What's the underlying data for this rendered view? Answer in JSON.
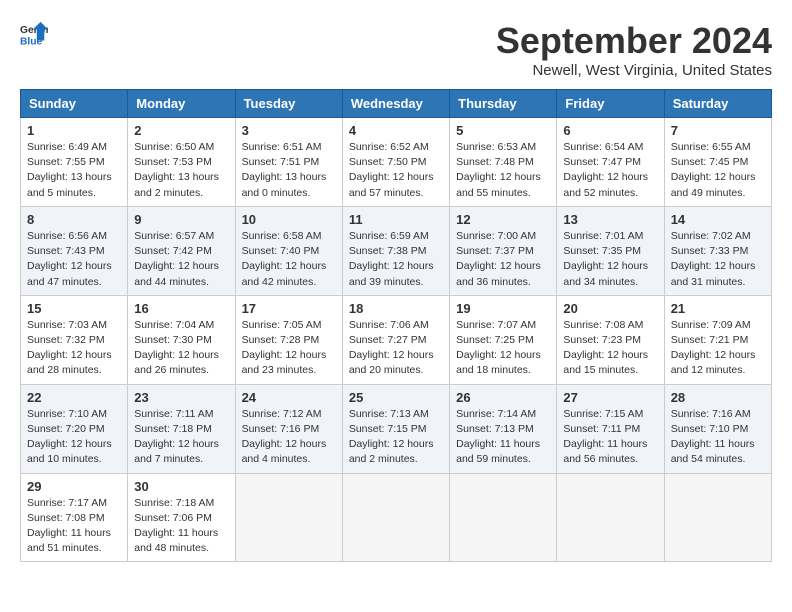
{
  "logo": {
    "general": "General",
    "blue": "Blue"
  },
  "title": "September 2024",
  "subtitle": "Newell, West Virginia, United States",
  "days_of_week": [
    "Sunday",
    "Monday",
    "Tuesday",
    "Wednesday",
    "Thursday",
    "Friday",
    "Saturday"
  ],
  "weeks": [
    [
      {
        "day": "1",
        "sunrise": "6:49 AM",
        "sunset": "7:55 PM",
        "daylight": "13 hours and 5 minutes."
      },
      {
        "day": "2",
        "sunrise": "6:50 AM",
        "sunset": "7:53 PM",
        "daylight": "13 hours and 2 minutes."
      },
      {
        "day": "3",
        "sunrise": "6:51 AM",
        "sunset": "7:51 PM",
        "daylight": "13 hours and 0 minutes."
      },
      {
        "day": "4",
        "sunrise": "6:52 AM",
        "sunset": "7:50 PM",
        "daylight": "12 hours and 57 minutes."
      },
      {
        "day": "5",
        "sunrise": "6:53 AM",
        "sunset": "7:48 PM",
        "daylight": "12 hours and 55 minutes."
      },
      {
        "day": "6",
        "sunrise": "6:54 AM",
        "sunset": "7:47 PM",
        "daylight": "12 hours and 52 minutes."
      },
      {
        "day": "7",
        "sunrise": "6:55 AM",
        "sunset": "7:45 PM",
        "daylight": "12 hours and 49 minutes."
      }
    ],
    [
      {
        "day": "8",
        "sunrise": "6:56 AM",
        "sunset": "7:43 PM",
        "daylight": "12 hours and 47 minutes."
      },
      {
        "day": "9",
        "sunrise": "6:57 AM",
        "sunset": "7:42 PM",
        "daylight": "12 hours and 44 minutes."
      },
      {
        "day": "10",
        "sunrise": "6:58 AM",
        "sunset": "7:40 PM",
        "daylight": "12 hours and 42 minutes."
      },
      {
        "day": "11",
        "sunrise": "6:59 AM",
        "sunset": "7:38 PM",
        "daylight": "12 hours and 39 minutes."
      },
      {
        "day": "12",
        "sunrise": "7:00 AM",
        "sunset": "7:37 PM",
        "daylight": "12 hours and 36 minutes."
      },
      {
        "day": "13",
        "sunrise": "7:01 AM",
        "sunset": "7:35 PM",
        "daylight": "12 hours and 34 minutes."
      },
      {
        "day": "14",
        "sunrise": "7:02 AM",
        "sunset": "7:33 PM",
        "daylight": "12 hours and 31 minutes."
      }
    ],
    [
      {
        "day": "15",
        "sunrise": "7:03 AM",
        "sunset": "7:32 PM",
        "daylight": "12 hours and 28 minutes."
      },
      {
        "day": "16",
        "sunrise": "7:04 AM",
        "sunset": "7:30 PM",
        "daylight": "12 hours and 26 minutes."
      },
      {
        "day": "17",
        "sunrise": "7:05 AM",
        "sunset": "7:28 PM",
        "daylight": "12 hours and 23 minutes."
      },
      {
        "day": "18",
        "sunrise": "7:06 AM",
        "sunset": "7:27 PM",
        "daylight": "12 hours and 20 minutes."
      },
      {
        "day": "19",
        "sunrise": "7:07 AM",
        "sunset": "7:25 PM",
        "daylight": "12 hours and 18 minutes."
      },
      {
        "day": "20",
        "sunrise": "7:08 AM",
        "sunset": "7:23 PM",
        "daylight": "12 hours and 15 minutes."
      },
      {
        "day": "21",
        "sunrise": "7:09 AM",
        "sunset": "7:21 PM",
        "daylight": "12 hours and 12 minutes."
      }
    ],
    [
      {
        "day": "22",
        "sunrise": "7:10 AM",
        "sunset": "7:20 PM",
        "daylight": "12 hours and 10 minutes."
      },
      {
        "day": "23",
        "sunrise": "7:11 AM",
        "sunset": "7:18 PM",
        "daylight": "12 hours and 7 minutes."
      },
      {
        "day": "24",
        "sunrise": "7:12 AM",
        "sunset": "7:16 PM",
        "daylight": "12 hours and 4 minutes."
      },
      {
        "day": "25",
        "sunrise": "7:13 AM",
        "sunset": "7:15 PM",
        "daylight": "12 hours and 2 minutes."
      },
      {
        "day": "26",
        "sunrise": "7:14 AM",
        "sunset": "7:13 PM",
        "daylight": "11 hours and 59 minutes."
      },
      {
        "day": "27",
        "sunrise": "7:15 AM",
        "sunset": "7:11 PM",
        "daylight": "11 hours and 56 minutes."
      },
      {
        "day": "28",
        "sunrise": "7:16 AM",
        "sunset": "7:10 PM",
        "daylight": "11 hours and 54 minutes."
      }
    ],
    [
      {
        "day": "29",
        "sunrise": "7:17 AM",
        "sunset": "7:08 PM",
        "daylight": "11 hours and 51 minutes."
      },
      {
        "day": "30",
        "sunrise": "7:18 AM",
        "sunset": "7:06 PM",
        "daylight": "11 hours and 48 minutes."
      },
      null,
      null,
      null,
      null,
      null
    ]
  ],
  "labels": {
    "sunrise": "Sunrise:",
    "sunset": "Sunset:",
    "daylight": "Daylight:"
  }
}
